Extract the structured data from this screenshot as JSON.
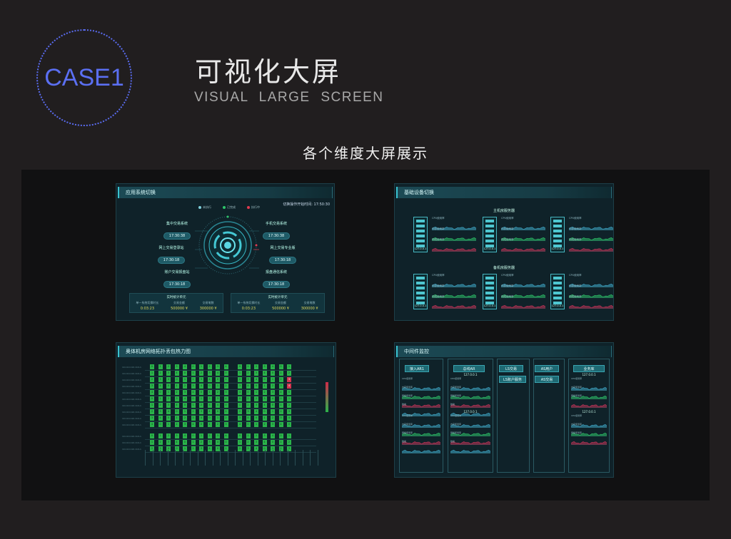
{
  "header": {
    "case_label": "CASE1",
    "title_cn": "可视化大屏",
    "title_en": "VISUAL LARGE SCREEN",
    "subtitle": "各个维度大屏展示"
  },
  "panel_app_switch": {
    "title": "应用系统切换",
    "legend": [
      "未执行",
      "已完成",
      "执行中"
    ],
    "time_corner": "切换操作开始时间: 17:50:30",
    "nodes": [
      {
        "name": "集中交易系统",
        "time": "17:30:38"
      },
      {
        "name": "手机交易系统",
        "time": "17:30:38"
      },
      {
        "name": "网上交易登录站",
        "time": "17:30:18"
      },
      {
        "name": "网上交易专业版",
        "time": "17:30:18"
      },
      {
        "name": "账户交易报盘站",
        "time": "17:30:18"
      },
      {
        "name": "报盘通信系统",
        "time": "17:30:18"
      }
    ],
    "stat_boxes": [
      {
        "title": "实时统计单元",
        "cells": [
          {
            "label": "单一系统切换时长",
            "value": "0:03:23"
          },
          {
            "label": "交易金额",
            "value": "500000 ¥"
          },
          {
            "label": "交易笔数",
            "value": "300000 ¥"
          }
        ]
      },
      {
        "title": "实时统计单元",
        "cells": [
          {
            "label": "单一系统切换时长",
            "value": "0:03:23"
          },
          {
            "label": "交易金额",
            "value": "500000 ¥"
          },
          {
            "label": "交易笔数",
            "value": "300000 ¥"
          }
        ]
      }
    ],
    "colors": {
      "pending": "#7fd0dc",
      "done": "#2ec56a",
      "running": "#e03a4f"
    }
  },
  "panel_devices": {
    "title": "基础设备切换",
    "group_main": "主机房服务器",
    "group_backup": "备机房服务器",
    "server_ip": "127.0.0.1",
    "metric_labels": [
      "CPU使用率",
      "内存使用率",
      "网络使用率"
    ]
  },
  "panel_heatmap": {
    "title": "奥体机房网络拓扑丢包热力图",
    "row_label": "10.110.110.110-1"
  },
  "panel_middleware": {
    "title": "中间件监控",
    "buttons": [
      "接入AR1",
      "总线AR",
      "LS交易",
      "AS用户",
      "业务库",
      "LS账户服务",
      "AS交易"
    ],
    "ip": "127.0.0.1",
    "metric_labels": [
      "CPU使用率",
      "内存使用率",
      "网络使用率",
      "磁盘"
    ]
  }
}
